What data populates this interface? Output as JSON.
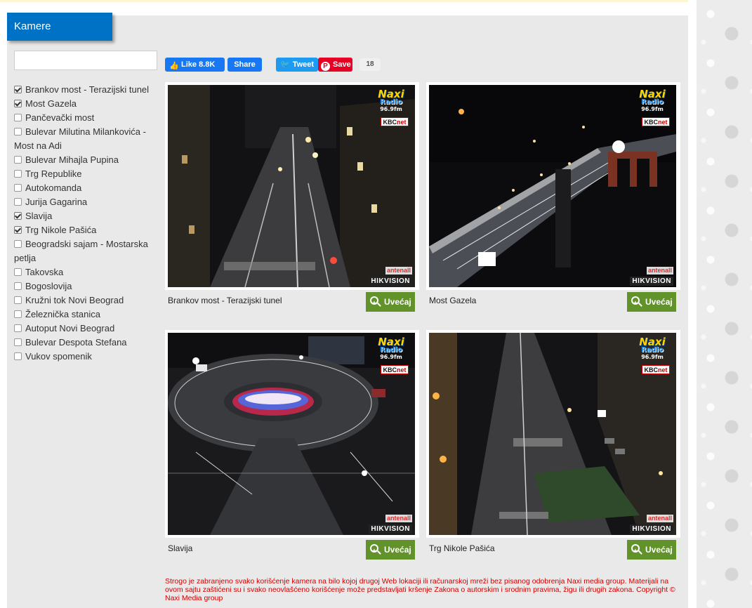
{
  "panel": {
    "title": "Kamere"
  },
  "search": {
    "placeholder": ""
  },
  "cameras": [
    {
      "label": "Brankov most - Terazijski tunel",
      "checked": true
    },
    {
      "label": "Most Gazela",
      "checked": true
    },
    {
      "label": "Pančevački most",
      "checked": false
    },
    {
      "label": "Bulevar Milutina Milankovića - Most na Adi",
      "checked": false
    },
    {
      "label": "Bulevar Mihajla Pupina",
      "checked": false
    },
    {
      "label": "Trg Republike",
      "checked": false
    },
    {
      "label": "Autokomanda",
      "checked": false
    },
    {
      "label": "Jurija Gagarina",
      "checked": false
    },
    {
      "label": "Slavija",
      "checked": true
    },
    {
      "label": "Trg Nikole Pašića",
      "checked": true
    },
    {
      "label": "Beogradski sajam - Mostarska petlja",
      "checked": false
    },
    {
      "label": "Takovska",
      "checked": false
    },
    {
      "label": "Bogoslovija",
      "checked": false
    },
    {
      "label": "Kružni tok Novi Beograd",
      "checked": false
    },
    {
      "label": "Železnička stanica",
      "checked": false
    },
    {
      "label": "Autoput Novi Beograd",
      "checked": false
    },
    {
      "label": "Bulevar Despota Stefana",
      "checked": false
    },
    {
      "label": "Vukov spomenik",
      "checked": false
    }
  ],
  "social": {
    "like_label": "Like 8.8K",
    "share_label": "Share",
    "tweet_label": "Tweet",
    "save_label": "Save",
    "save_count": "18"
  },
  "cards": [
    {
      "caption": "Brankov most - Terazijski tunel",
      "button": "Uvećaj"
    },
    {
      "caption": "Most Gazela",
      "button": "Uvećaj"
    },
    {
      "caption": "Slavija",
      "button": "Uvećaj"
    },
    {
      "caption": "Trg Nikole Pašića",
      "button": "Uvećaj"
    }
  ],
  "overlay": {
    "naxi_1": "Naxi",
    "naxi_2": "Radio",
    "naxi_3": "96.9fm",
    "kbc_a": "KBC",
    "kbc_b": "net",
    "antenall": "antenall",
    "hikvision": "HIKVISION"
  },
  "disclaimer": "Strogo je zabranjeno svako korišćenje kamera na bilo kojoj drugoj Web lokaciji ili računarskoj mreži bez pisanog odobrenja Naxi media group. Materijali na ovom sajtu zaštićeni su i svako neovlašćeno korišćenje može predstavljati kršenje Zakona o autorskim i srodnim pravima, žigu ili drugih zakona. Copyright © Naxi Media group",
  "colors": {
    "accent": "#0072c6",
    "zoom_button": "#62932b",
    "disclaimer": "#d00000"
  }
}
